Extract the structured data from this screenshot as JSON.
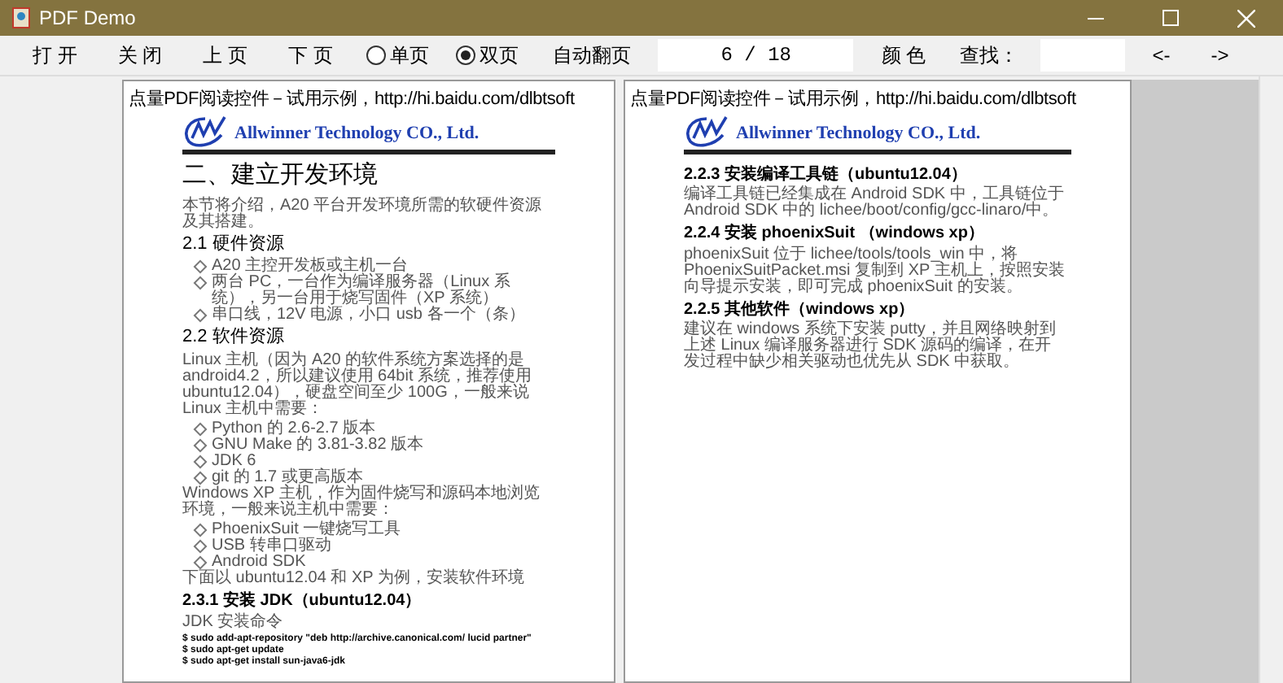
{
  "window": {
    "title": "PDF Demo"
  },
  "toolbar": [
    {
      "kind": "button",
      "text": "打 开"
    },
    {
      "kind": "button",
      "text": "关 闭"
    },
    {
      "kind": "button",
      "text": "上 页"
    },
    {
      "kind": "button",
      "text": "下 页"
    },
    {
      "kind": "radio",
      "text": "单页",
      "selected": false
    },
    {
      "kind": "radio",
      "text": "双页",
      "selected": true
    },
    {
      "kind": "button",
      "text": "自动翻页"
    },
    {
      "kind": "field",
      "text": "6 / 18"
    },
    {
      "kind": "button",
      "text": "颜 色"
    },
    {
      "kind": "label",
      "text": "查找："
    },
    {
      "kind": "field"
    },
    {
      "kind": "button",
      "text": "<-"
    },
    {
      "kind": "button",
      "text": "->"
    }
  ],
  "pages": [
    {
      "banner": "点量PDF阅读控件－试用示例，http://hi.baidu.com/dlbtsoft",
      "company": "Allwinner Technology CO., Ltd.",
      "blocks": [
        {
          "kind": "h1",
          "text": "二、建立开发环境"
        },
        {
          "kind": "para",
          "text": "本节将介绍，A20 平台开发环境所需的软硬件资源及其搭建。"
        },
        {
          "kind": "h2",
          "text": "2.1 硬件资源"
        },
        {
          "kind": "bullet",
          "text": "A20 主控开发板或主机一台"
        },
        {
          "kind": "bullet",
          "text": "两台 PC，一台作为编译服务器（Linux 系统），另一台用于烧写固件（XP 系统）"
        },
        {
          "kind": "bullet",
          "text": "串口线，12V 电源，小口 usb 各一个（条）"
        },
        {
          "kind": "h2",
          "text": "2.2 软件资源"
        },
        {
          "kind": "para",
          "text": "Linux 主机（因为 A20 的软件系统方案选择的是 android4.2，所以建议使用 64bit 系统，推荐使用 ubuntu12.04），硬盘空间至少 100G，一般来说 Linux 主机中需要："
        },
        {
          "kind": "bullet",
          "text": "Python 的 2.6-2.7 版本"
        },
        {
          "kind": "bullet",
          "text": "GNU Make 的 3.81-3.82 版本"
        },
        {
          "kind": "bullet",
          "text": "JDK 6"
        },
        {
          "kind": "bullet",
          "text": "git 的 1.7 或更高版本"
        },
        {
          "kind": "para",
          "text": "Windows XP 主机，作为固件烧写和源码本地浏览环境，一般来说主机中需要："
        },
        {
          "kind": "bullet",
          "text": "PhoenixSuit 一键烧写工具"
        },
        {
          "kind": "bullet",
          "text": "USB 转串口驱动"
        },
        {
          "kind": "bullet",
          "text": "Android SDK"
        },
        {
          "kind": "para",
          "text": "下面以 ubuntu12.04 和 XP 为例，安装软件环境"
        },
        {
          "kind": "h3",
          "text": "2.3.1 安装 JDK（ubuntu12.04）"
        },
        {
          "kind": "para",
          "text": "JDK 安装命令"
        },
        {
          "kind": "code",
          "text": "$ sudo add-apt-repository \"deb http://archive.canonical.com/ lucid partner\""
        },
        {
          "kind": "code",
          "text": "$ sudo apt-get update"
        },
        {
          "kind": "code",
          "text": "$ sudo apt-get install sun-java6-jdk"
        }
      ]
    },
    {
      "banner": "点量PDF阅读控件－试用示例，http://hi.baidu.com/dlbtsoft",
      "company": "Allwinner Technology CO., Ltd.",
      "blocks": [
        {
          "kind": "h3",
          "text": "2.2.3 安装编译工具链（ubuntu12.04）"
        },
        {
          "kind": "para",
          "text": "编译工具链已经集成在 Android SDK 中，工具链位于 Android SDK 中的 lichee/boot/config/gcc-linaro/中。"
        },
        {
          "kind": "h3",
          "text": "2.2.4 安装 phoenixSuit （windows xp）"
        },
        {
          "kind": "para",
          "text": "phoenixSuit 位于 lichee/tools/tools_win 中，将 PhoenixSuitPacket.msi 复制到 XP 主机上，按照安装向导提示安装，即可完成 phoenixSuit 的安装。"
        },
        {
          "kind": "h3",
          "text": "2.2.5 其他软件（windows xp）"
        },
        {
          "kind": "para",
          "text": "建议在 windows 系统下安装 putty，并且网络映射到上述 Linux 编译服务器进行 SDK 源码的编译，在开发过程中缺少相关驱动也优先从 SDK 中获取。"
        }
      ]
    }
  ]
}
